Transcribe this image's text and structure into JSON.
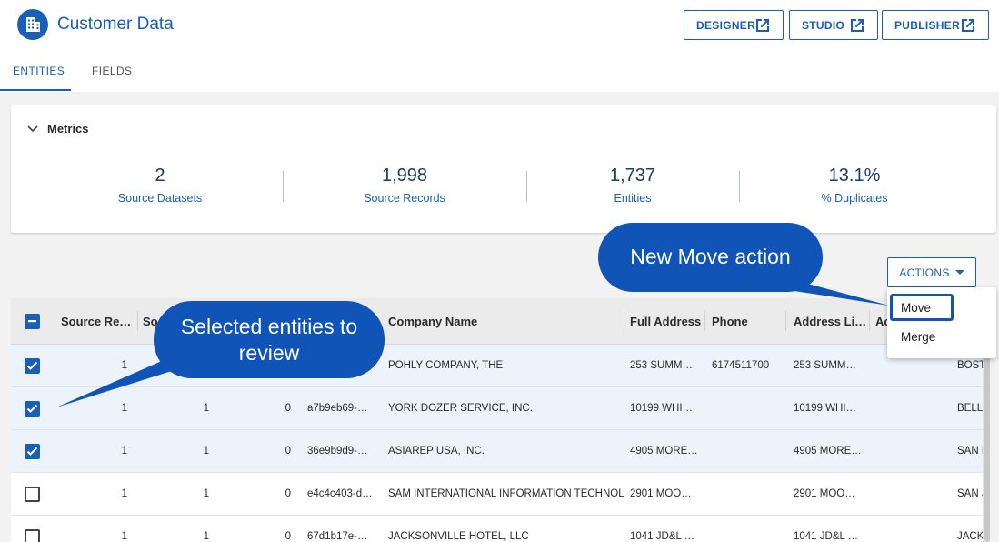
{
  "header": {
    "title": "Customer Data",
    "buttons": {
      "designer": "DESIGNER",
      "studio": "STUDIO",
      "publisher": "PUBLISHER"
    },
    "icon": "building-icon"
  },
  "tabs": [
    {
      "label": "ENTITIES",
      "active": true
    },
    {
      "label": "FIELDS",
      "active": false
    }
  ],
  "metrics": {
    "title": "Metrics",
    "items": [
      {
        "value": "2",
        "label": "Source Datasets"
      },
      {
        "value": "1,998",
        "label": "Source Records"
      },
      {
        "value": "1,737",
        "label": "Entities"
      },
      {
        "value": "13.1%",
        "label": "% Duplicates"
      }
    ]
  },
  "actions": {
    "label": "ACTIONS",
    "menu": [
      "Move",
      "Merge"
    ]
  },
  "table": {
    "columns": [
      "Source Re…",
      "So",
      "",
      "",
      "Company Name",
      "Full Address",
      "Phone",
      "Address Li…",
      "Ac",
      ""
    ],
    "rows": [
      {
        "selected": true,
        "c1": "1",
        "c2": "",
        "c3": "",
        "c4": "",
        "company": "POHLY COMPANY, THE",
        "address": "253 SUMM…",
        "phone": "6174511700",
        "addr_line": "253 SUMM…",
        "city": "BOST"
      },
      {
        "selected": true,
        "c1": "1",
        "c2": "1",
        "c3": "0",
        "c4": "a7b9eb69-…",
        "company": "YORK DOZER SERVICE, INC.",
        "address": "10199 WHI…",
        "phone": "",
        "addr_line": "10199 WHI…",
        "city": "BELL"
      },
      {
        "selected": true,
        "c1": "1",
        "c2": "1",
        "c3": "0",
        "c4": "36e9b9d9-…",
        "company": "ASIAREP USA, INC.",
        "address": "4905 MORE…",
        "phone": "",
        "addr_line": "4905 MORE…",
        "city": "SAN F"
      },
      {
        "selected": false,
        "c1": "1",
        "c2": "1",
        "c3": "0",
        "c4": "e4c4c403-d…",
        "company": "SAM INTERNATIONAL INFORMATION TECHNOLOGY",
        "address": "2901 MOO…",
        "phone": "",
        "addr_line": "2901 MOO…",
        "city": "SAN J"
      },
      {
        "selected": false,
        "c1": "1",
        "c2": "1",
        "c3": "0",
        "c4": "67d1b17e-…",
        "company": "JACKSONVILLE HOTEL, LLC",
        "address": "1041 JD&L …",
        "phone": "",
        "addr_line": "1041 JD&L …",
        "city": "JACK"
      }
    ]
  },
  "callouts": {
    "move": "New Move action",
    "selected_line1": "Selected entities to",
    "selected_line2": "review"
  },
  "colors": {
    "brand": "#1a5fb4",
    "callout": "#1054b8"
  }
}
